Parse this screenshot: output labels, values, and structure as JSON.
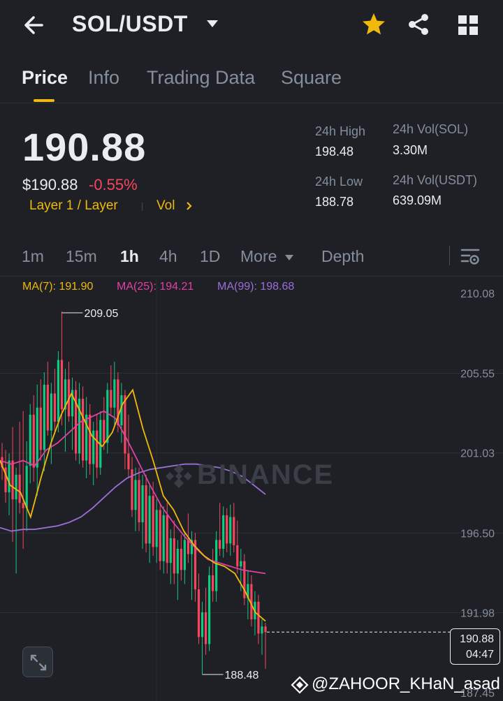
{
  "header": {
    "title": "SOL/USDT"
  },
  "tabs": [
    {
      "label": "Price"
    },
    {
      "label": "Info"
    },
    {
      "label": "Trading Data"
    },
    {
      "label": "Square"
    }
  ],
  "price": {
    "last": "190.88",
    "usd": "$190.88",
    "change": "-0.55%",
    "tag": "Layer 1 / Layer",
    "vol_link": "Vol"
  },
  "stats": {
    "high_label": "24h High",
    "high_value": "198.48",
    "low_label": "24h Low",
    "low_value": "188.78",
    "vol_sol_label": "24h Vol(SOL)",
    "vol_sol_value": "3.30M",
    "vol_usdt_label": "24h Vol(USDT)",
    "vol_usdt_value": "639.09M"
  },
  "intervals": [
    {
      "label": "1m"
    },
    {
      "label": "15m"
    },
    {
      "label": "1h"
    },
    {
      "label": "4h"
    },
    {
      "label": "1D"
    },
    {
      "label": "More"
    },
    {
      "label": "Depth"
    }
  ],
  "ma": {
    "ma7": "MA(7): 191.90",
    "ma25": "MA(25): 194.21",
    "ma99": "MA(99): 198.68"
  },
  "colors": {
    "up": "#0ecb81",
    "down": "#f6465d",
    "accent": "#f0b90b",
    "ma7": "#f0b90b",
    "ma25": "#e240a5",
    "ma99": "#9b6ed8"
  },
  "chart_data": {
    "type": "candlestick",
    "y_ticks": [
      "210.08",
      "205.55",
      "201.03",
      "196.50",
      "191.98",
      "187.45"
    ],
    "ylim": [
      187.45,
      210.08
    ],
    "annotations": {
      "high": "209.05",
      "low": "188.48"
    },
    "last_price": "190.88",
    "countdown": "04:47",
    "watermark": "BINANCE",
    "candles": [
      [
        200.8,
        201.6,
        199.5,
        200.2
      ],
      [
        200.2,
        201.2,
        198.2,
        198.8
      ],
      [
        198.8,
        201.0,
        197.5,
        200.6
      ],
      [
        200.6,
        202.5,
        196.0,
        198.4
      ],
      [
        198.4,
        200.2,
        194.2,
        199.8
      ],
      [
        199.8,
        202.8,
        197.6,
        198.2
      ],
      [
        198.2,
        203.4,
        195.6,
        197.9
      ],
      [
        197.9,
        201.7,
        196.6,
        200.3
      ],
      [
        200.3,
        203.8,
        199.3,
        203.2
      ],
      [
        203.2,
        204.3,
        199.4,
        200.2
      ],
      [
        200.2,
        204.9,
        198.6,
        203.6
      ],
      [
        203.6,
        205.2,
        200.6,
        201.2
      ],
      [
        201.2,
        205.6,
        200.0,
        204.9
      ],
      [
        204.9,
        206.2,
        202.0,
        202.3
      ],
      [
        202.3,
        205.0,
        200.4,
        204.4
      ],
      [
        204.4,
        205.8,
        202.1,
        202.8
      ],
      [
        202.8,
        206.8,
        202.2,
        206.3
      ],
      [
        206.3,
        209.05,
        202.6,
        203.5
      ],
      [
        203.5,
        205.8,
        201.1,
        205.2
      ],
      [
        205.2,
        206.2,
        202.8,
        203.1
      ],
      [
        203.1,
        205.3,
        201.2,
        204.6
      ],
      [
        204.6,
        205.1,
        200.6,
        201.0
      ],
      [
        201.0,
        205.0,
        200.4,
        204.1
      ],
      [
        204.1,
        204.8,
        200.2,
        200.6
      ],
      [
        200.6,
        204.2,
        199.6,
        203.2
      ],
      [
        203.2,
        203.8,
        199.8,
        200.4
      ],
      [
        200.4,
        202.8,
        199.2,
        202.3
      ],
      [
        202.3,
        203.2,
        199.6,
        200.2
      ],
      [
        200.2,
        203.4,
        199.8,
        202.9
      ],
      [
        202.9,
        204.2,
        201.2,
        201.6
      ],
      [
        201.6,
        205.0,
        201.0,
        204.6
      ],
      [
        204.6,
        206.0,
        203.2,
        203.6
      ],
      [
        203.6,
        206.2,
        202.6,
        205.2
      ],
      [
        205.2,
        205.6,
        202.2,
        202.6
      ],
      [
        202.6,
        205.0,
        201.6,
        204.3
      ],
      [
        204.3,
        204.6,
        200.1,
        201.0
      ],
      [
        201.0,
        203.2,
        199.6,
        200.1
      ],
      [
        200.1,
        200.8,
        197.4,
        197.8
      ],
      [
        197.8,
        200.2,
        196.6,
        199.5
      ],
      [
        199.5,
        200.2,
        196.6,
        197.1
      ],
      [
        197.1,
        199.8,
        195.6,
        199.2
      ],
      [
        199.2,
        199.8,
        195.4,
        195.9
      ],
      [
        195.9,
        199.2,
        194.8,
        198.6
      ],
      [
        198.6,
        199.4,
        195.2,
        195.7
      ],
      [
        195.7,
        198.4,
        194.8,
        197.8
      ],
      [
        197.8,
        198.2,
        194.4,
        194.9
      ],
      [
        194.9,
        198.0,
        194.2,
        197.5
      ],
      [
        197.5,
        198.2,
        194.2,
        194.8
      ],
      [
        194.8,
        196.7,
        193.6,
        196.2
      ],
      [
        196.2,
        197.2,
        193.6,
        194.2
      ],
      [
        194.2,
        196.1,
        192.7,
        195.6
      ],
      [
        195.6,
        196.4,
        193.8,
        194.4
      ],
      [
        194.4,
        196.6,
        193.6,
        196.1
      ],
      [
        196.1,
        197.6,
        194.8,
        195.3
      ],
      [
        195.3,
        196.6,
        192.7,
        196.1
      ],
      [
        196.1,
        196.5,
        192.6,
        193.3
      ],
      [
        193.3,
        194.2,
        190.2,
        190.6
      ],
      [
        190.6,
        192.6,
        188.48,
        192.0
      ],
      [
        192.0,
        193.4,
        189.6,
        190.2
      ],
      [
        190.2,
        194.6,
        189.8,
        194.1
      ],
      [
        194.1,
        195.6,
        192.6,
        193.2
      ],
      [
        193.2,
        196.6,
        192.6,
        196.1
      ],
      [
        196.1,
        198.2,
        195.2,
        195.6
      ],
      [
        195.6,
        198.0,
        195.1,
        197.5
      ],
      [
        197.5,
        197.9,
        195.4,
        195.9
      ],
      [
        195.9,
        198.1,
        195.2,
        197.4
      ],
      [
        197.4,
        198.2,
        195.4,
        195.8
      ],
      [
        195.8,
        197.2,
        194.2,
        194.6
      ],
      [
        194.6,
        195.6,
        193.2,
        194.9
      ],
      [
        194.9,
        195.3,
        192.4,
        192.8
      ],
      [
        192.8,
        194.4,
        191.6,
        193.6
      ],
      [
        193.6,
        194.1,
        191.2,
        191.6
      ],
      [
        191.6,
        193.2,
        190.7,
        192.6
      ],
      [
        192.6,
        193.0,
        190.2,
        190.8
      ],
      [
        190.8,
        191.6,
        189.6,
        191.2
      ],
      [
        191.2,
        191.4,
        188.8,
        190.88
      ]
    ],
    "ma7_values": [
      [
        200.6,
        199.2,
        198.8,
        197.4,
        199.6,
        201.6,
        203.2,
        204.4,
        203.2,
        202.0,
        201.4,
        202.2,
        203.8,
        204.6,
        202.4,
        200.6,
        198.6,
        197.8,
        196.6,
        195.8,
        195.2,
        194.8,
        194.6,
        194.2,
        193.2,
        192.0,
        191.5
      ]
    ],
    "ma25_values": [
      200.6,
      200.4,
      200.6,
      200.3,
      201.2,
      201.6,
      202.2,
      202.8,
      203.1,
      203.4,
      203.0,
      201.8,
      200.5,
      199.2,
      198.0,
      197.1,
      196.3,
      195.6,
      195.0,
      194.8,
      194.6,
      194.4,
      194.3,
      194.2
    ],
    "ma99_values": [
      196.8,
      196.6,
      196.7,
      196.7,
      196.8,
      196.9,
      197.1,
      197.4,
      197.9,
      198.5,
      199.1,
      199.6,
      199.9,
      200.1,
      200.2,
      200.3,
      200.4,
      200.4,
      200.3,
      200.2,
      200.0,
      199.7,
      199.2,
      198.68
    ]
  },
  "credit": "@ZAHOOR_KHaN_asad"
}
